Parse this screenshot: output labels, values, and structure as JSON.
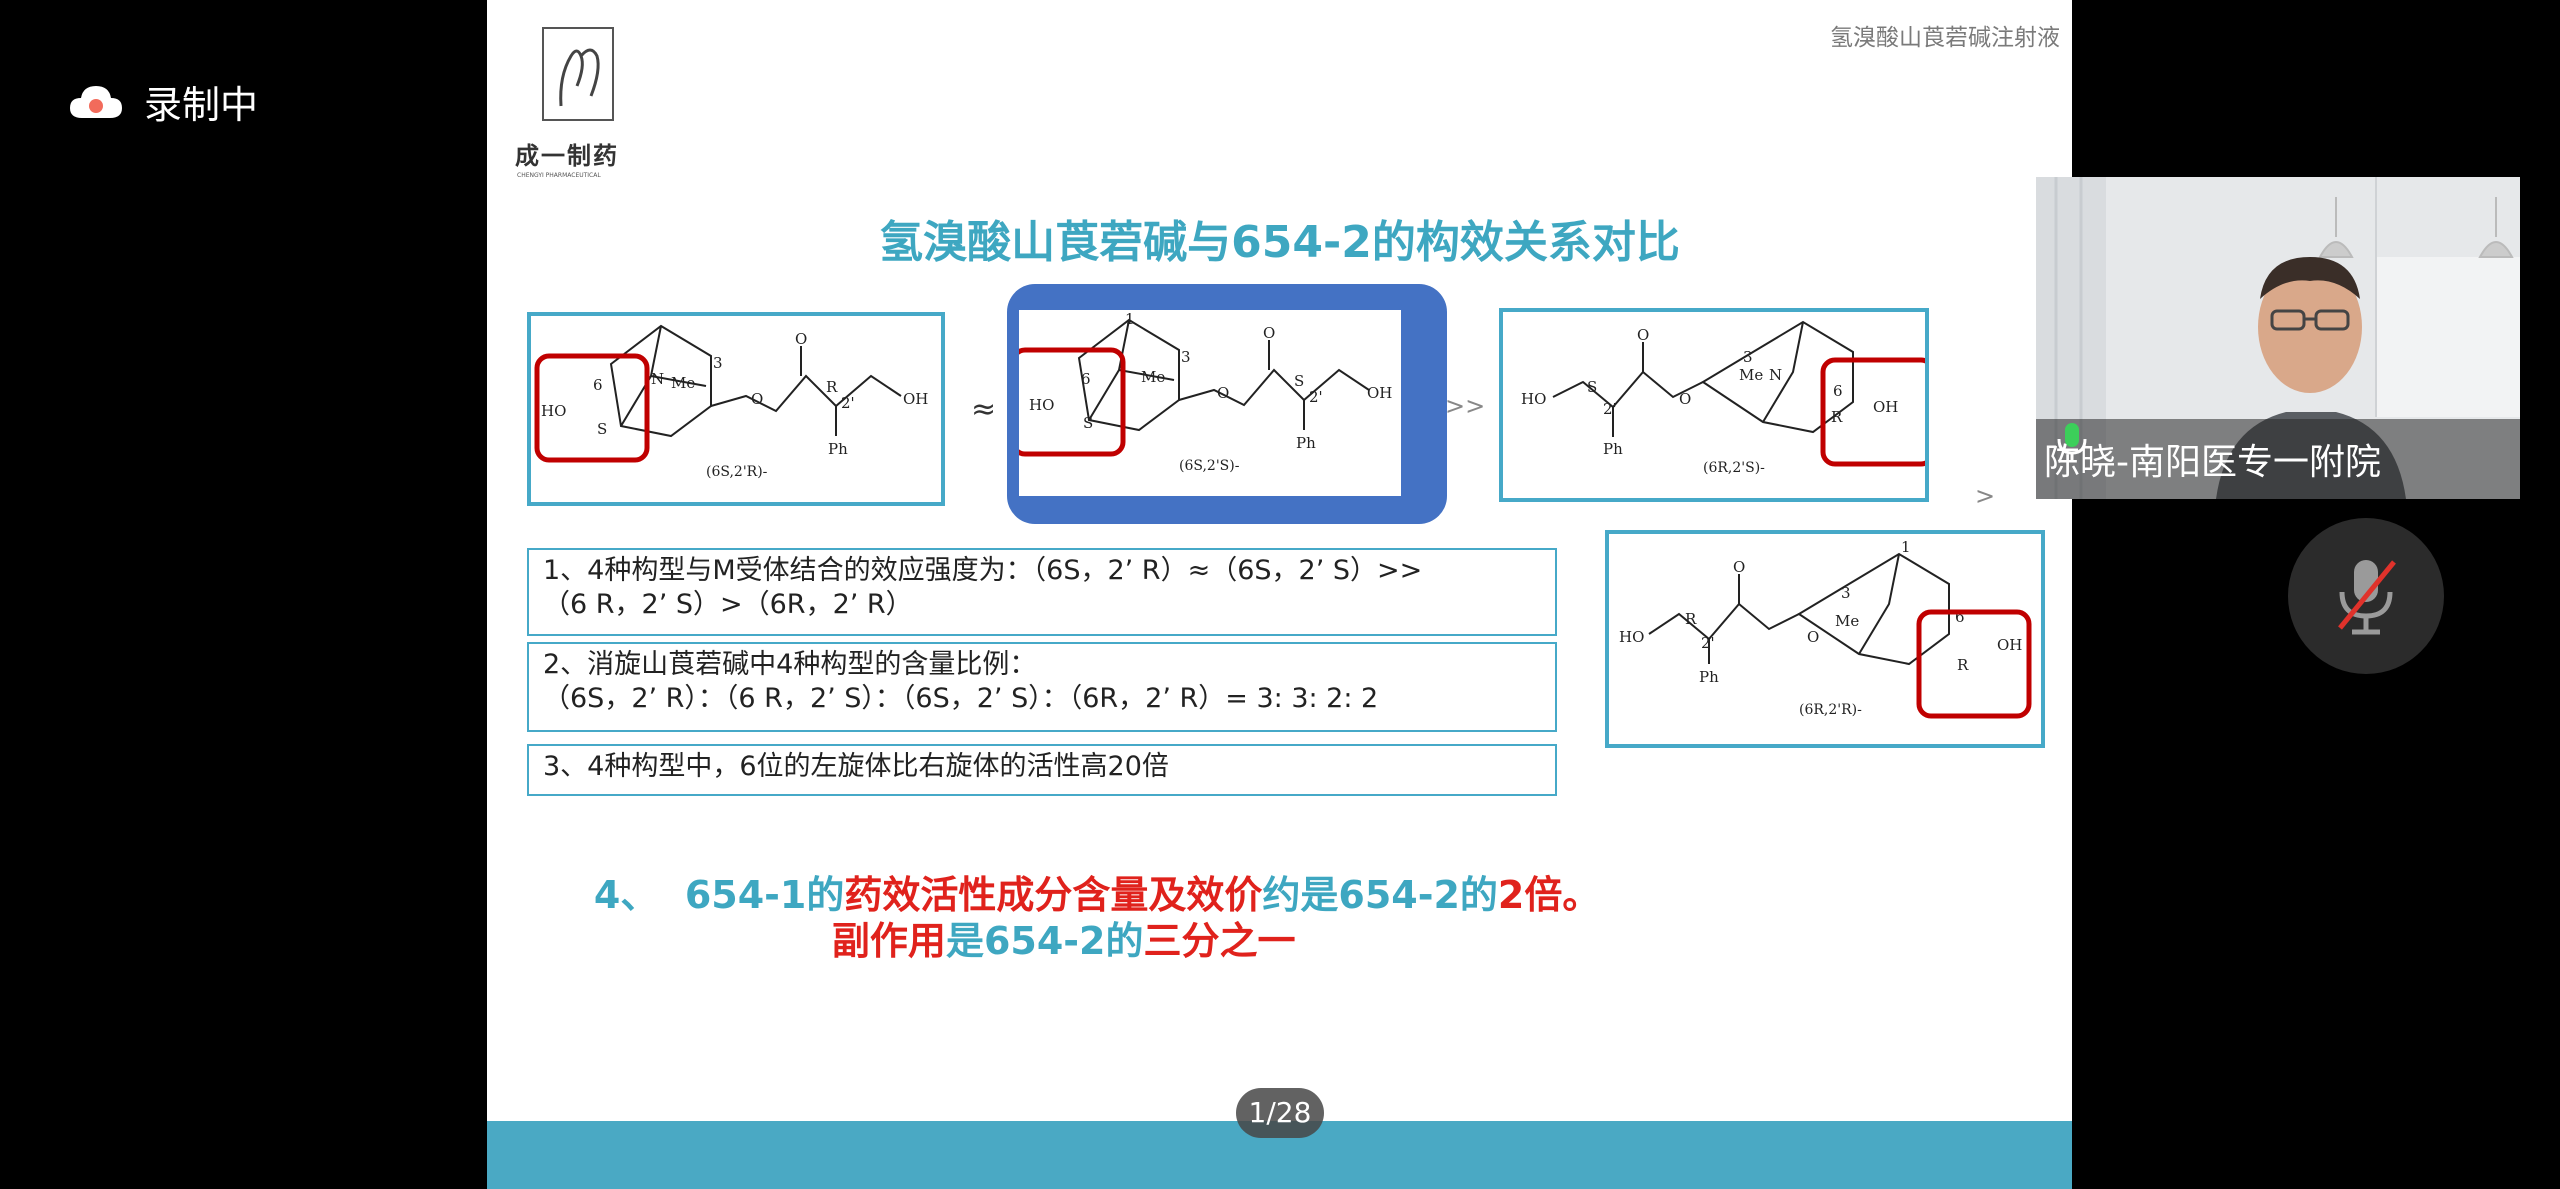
{
  "recording": {
    "label": "录制中"
  },
  "slide": {
    "top_title": "氢溴酸山莨菪碱注射液",
    "logo": {
      "name": "成一制药",
      "sub": "CHENGYI PHARMACEUTICAL"
    },
    "title": "氢溴酸山莨菪碱与654-2的构效关系对比",
    "molecules": [
      {
        "label": "(6S,2'R)-"
      },
      {
        "label": "(6S,2'S)-"
      },
      {
        "label": "(6R,2'S)-"
      },
      {
        "label": "(6R,2'R)-"
      }
    ],
    "symbols": {
      "approx": "≈",
      "gg": ">>",
      "gt": ">"
    },
    "statements": [
      {
        "line1": "1、4种构型与M受体结合的效应强度为：（6S，2’ R）≈（6S，2’ S）>>",
        "line2": "（6 R，2’ S）>（6R，2’ R）"
      },
      {
        "line1": "2、消旋山莨菪碱中4种构型的含量比例：",
        "line2": "（6S，2’ R）：（6 R，2’ S）：（6S，2’ S）：（6R，2’ R）= 3: 3: 2: 2"
      },
      {
        "line1": "3、4种构型中，6位的左旋体比右旋体的活性高20倍"
      }
    ],
    "conclusion": {
      "p1": "4、  654-1的",
      "p2": "药效活性成分含量及效价",
      "p3": "约是654-2的",
      "p4": "2倍。",
      "p5": "副作用",
      "p6": "是654-2的",
      "p7": "三分之一"
    },
    "page_indicator": "1/28"
  },
  "participant": {
    "name": "陈晓-南阳医专一附院"
  },
  "colors": {
    "accent": "#46a9c8",
    "highlight_red": "#c00000",
    "selected_blue": "#4472c4"
  },
  "icons": [
    "cloud-icon",
    "mic-icon",
    "mic-muted-icon"
  ]
}
